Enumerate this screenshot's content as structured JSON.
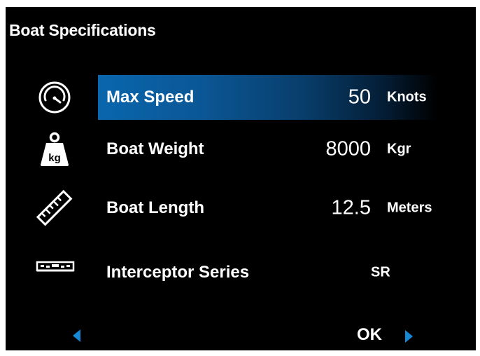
{
  "header": {
    "title": "Boat Specifications"
  },
  "specs": [
    {
      "label": "Max Speed",
      "value": "50",
      "unit": "Knots",
      "icon": "speedometer-icon",
      "selected": true
    },
    {
      "label": "Boat Weight",
      "value": "8000",
      "unit": "Kgr",
      "icon": "weight-kg-icon",
      "selected": false
    },
    {
      "label": "Boat Length",
      "value": "12.5",
      "unit": "Meters",
      "icon": "ruler-icon",
      "selected": false
    }
  ],
  "interceptor": {
    "label": "Interceptor Series",
    "value": "SR",
    "icon": "interceptor-icon"
  },
  "icons": {
    "weight_text": "kg"
  },
  "footer": {
    "ok_label": "OK",
    "prev_icon": "chevron-left-icon",
    "next_icon": "chevron-right-icon"
  },
  "colors": {
    "background": "#000000",
    "highlight": "#0a66ad",
    "arrow": "#1688d4",
    "text": "#ffffff"
  }
}
